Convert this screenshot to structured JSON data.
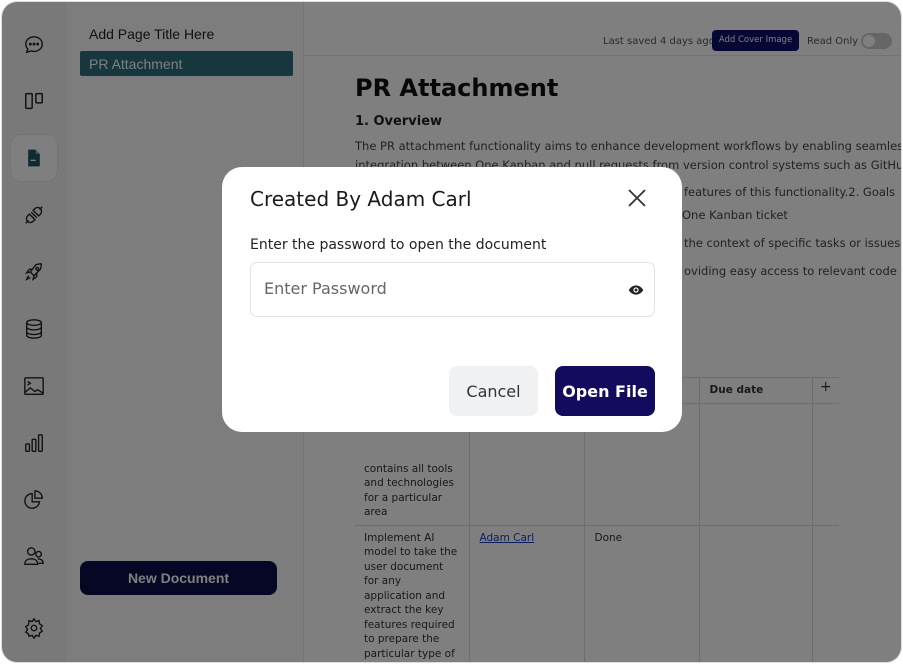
{
  "rail": {
    "items": [
      "chat-icon",
      "board-icon",
      "document-icon",
      "plugin-icon",
      "rocket-icon",
      "database-icon",
      "image-icon",
      "bar-chart-icon",
      "pie-chart-icon",
      "users-icon",
      "settings-icon"
    ],
    "active": "document-icon"
  },
  "sidebar": {
    "page_title": "Add Page Title Here",
    "selected_page": "PR Attachment",
    "new_document": "New Document"
  },
  "topbar": {
    "last_saved": "Last saved 4 days ago",
    "add_cover": "Add Cover Image",
    "read_only": "Read Only",
    "read_only_on": false
  },
  "doc": {
    "title": "PR Attachment",
    "section": "1. Overview",
    "para1": "The PR attachment functionality aims to enhance development workflows by enabling seamless",
    "para2": "integration between One Kanban and pull requests from version control systems such as GitHub,",
    "para3": "features of this functionality.2. Goals",
    "line4": "One Kanban ticket",
    "line5": "the context of specific tasks or issues.",
    "line6": "oviding easy access to relevant code",
    "table": {
      "header_due": "Due date",
      "add_col": "+",
      "row1_task": "contains all tools and technologies for a particular area",
      "row2_task": "Implement AI model to take the user document for any application and extract the key features required to prepare the particular type of block diagram",
      "row2_assignee": "Adam Carl",
      "row2_status": "Done"
    }
  },
  "modal": {
    "title": "Created By Adam Carl",
    "label": "Enter the password to open the document",
    "placeholder": "Enter Password",
    "value": "",
    "cancel": "Cancel",
    "open": "Open File"
  },
  "colors": {
    "primary": "#130c5e",
    "selected": "#2a6e7a",
    "overlay": "rgba(0,0,0,0.5)"
  }
}
